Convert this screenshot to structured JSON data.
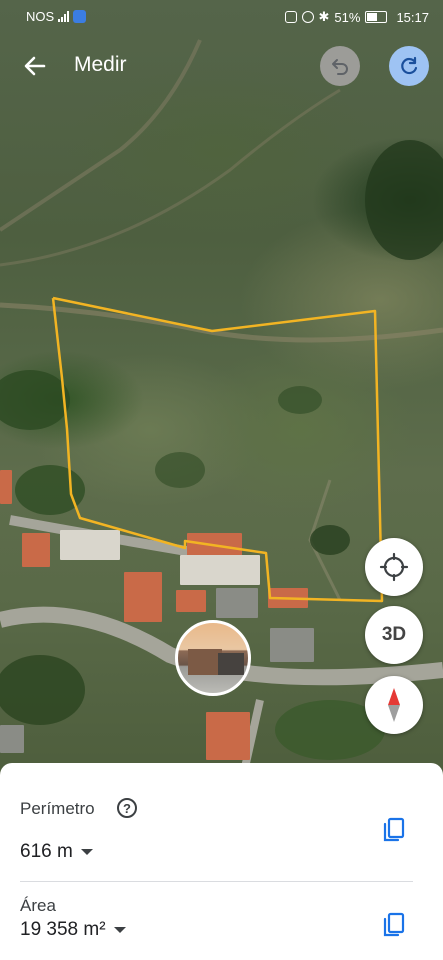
{
  "status_bar": {
    "carrier": "NOS",
    "battery": "51%",
    "time": "15:17"
  },
  "header": {
    "title": "Medir"
  },
  "map_controls": {
    "three_d_label": "3D"
  },
  "sheet": {
    "perimeter_label": "Perímetro",
    "perimeter_value": "616 m",
    "area_label": "Área",
    "area_value": "19 358 m²"
  },
  "colors": {
    "measurement_line": "#f2b423",
    "redo_button": "#9ec3f3",
    "copy_icon": "#1a73e8"
  }
}
